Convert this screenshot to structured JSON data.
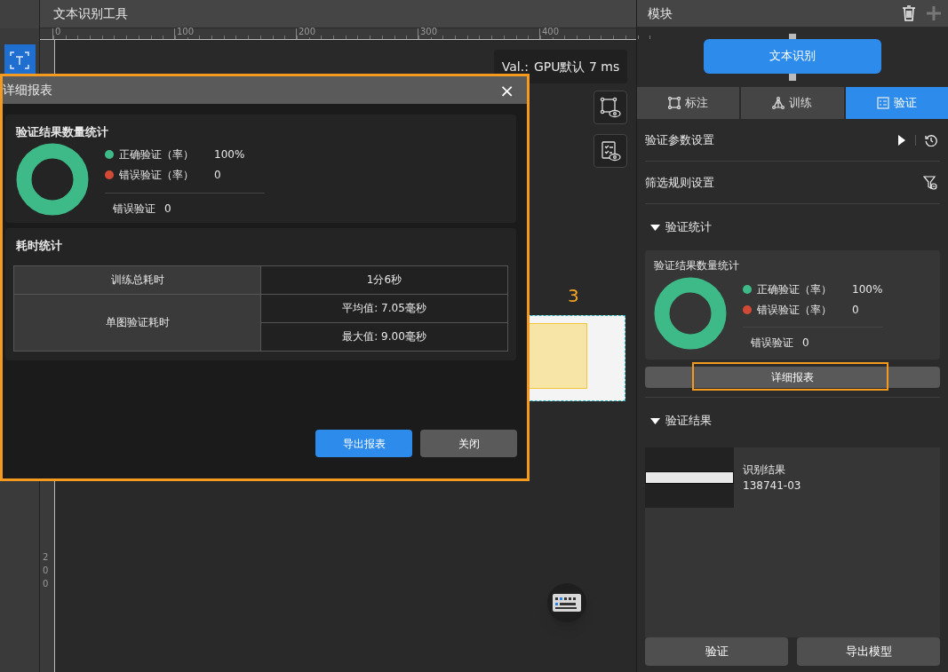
{
  "tool_title": "文本识别工具",
  "left_toolbar": [
    {
      "kind": "text-tool",
      "selected": true
    }
  ],
  "ruler": {
    "top_labels": [
      "0",
      "100",
      "200",
      "300",
      "400"
    ],
    "left_labels": [
      "200"
    ]
  },
  "canvas": {
    "val_label": "Val.:",
    "val_text": "GPU默认 7 ms",
    "annotation_label": "3"
  },
  "dialog": {
    "title": "详细报表",
    "close": "×",
    "stats": {
      "title": "验证结果数量统计",
      "legend": [
        {
          "label": "正确验证（率）",
          "value": "100%",
          "color": "#3dba87"
        },
        {
          "label": "错误验证（率）",
          "value": "0",
          "color": "#d24a35"
        }
      ],
      "error_label": "错误验证",
      "error_value": "0"
    },
    "time": {
      "title": "耗时统计",
      "rows": [
        {
          "label": "训练总耗时",
          "values": [
            "1分6秒"
          ]
        },
        {
          "label": "单图验证耗时",
          "values": [
            "平均值: 7.05毫秒",
            "最大值: 9.00毫秒"
          ]
        }
      ]
    },
    "buttons": [
      {
        "label": "导出报表",
        "kind": "primary"
      },
      {
        "label": "关闭",
        "kind": "secondary"
      }
    ]
  },
  "panel": {
    "title": "模块",
    "node": "文本识别",
    "tabs": [
      {
        "label": "标注",
        "kind": "annotate",
        "selected": false
      },
      {
        "label": "训练",
        "kind": "train",
        "selected": false
      },
      {
        "label": "验证",
        "kind": "verify",
        "selected": true
      }
    ],
    "settings": [
      {
        "label": "验证参数设置",
        "kind": "params"
      },
      {
        "label": "筛选规则设置",
        "kind": "filter"
      }
    ],
    "stats_section": {
      "title": "验证统计",
      "expanded": true,
      "card_title": "验证结果数量统计",
      "legend": [
        {
          "label": "正确验证（率）",
          "value": "100%",
          "color": "#3dba87"
        },
        {
          "label": "错误验证（率）",
          "value": "0",
          "color": "#d24a35"
        }
      ],
      "error_label": "错误验证",
      "error_value": "0",
      "report_button": "详细报表"
    },
    "result_section": {
      "title": "验证结果",
      "expanded": true,
      "result_label": "识别结果",
      "result_value": "138741-03"
    },
    "buttons": [
      "验证",
      "导出模型"
    ]
  }
}
